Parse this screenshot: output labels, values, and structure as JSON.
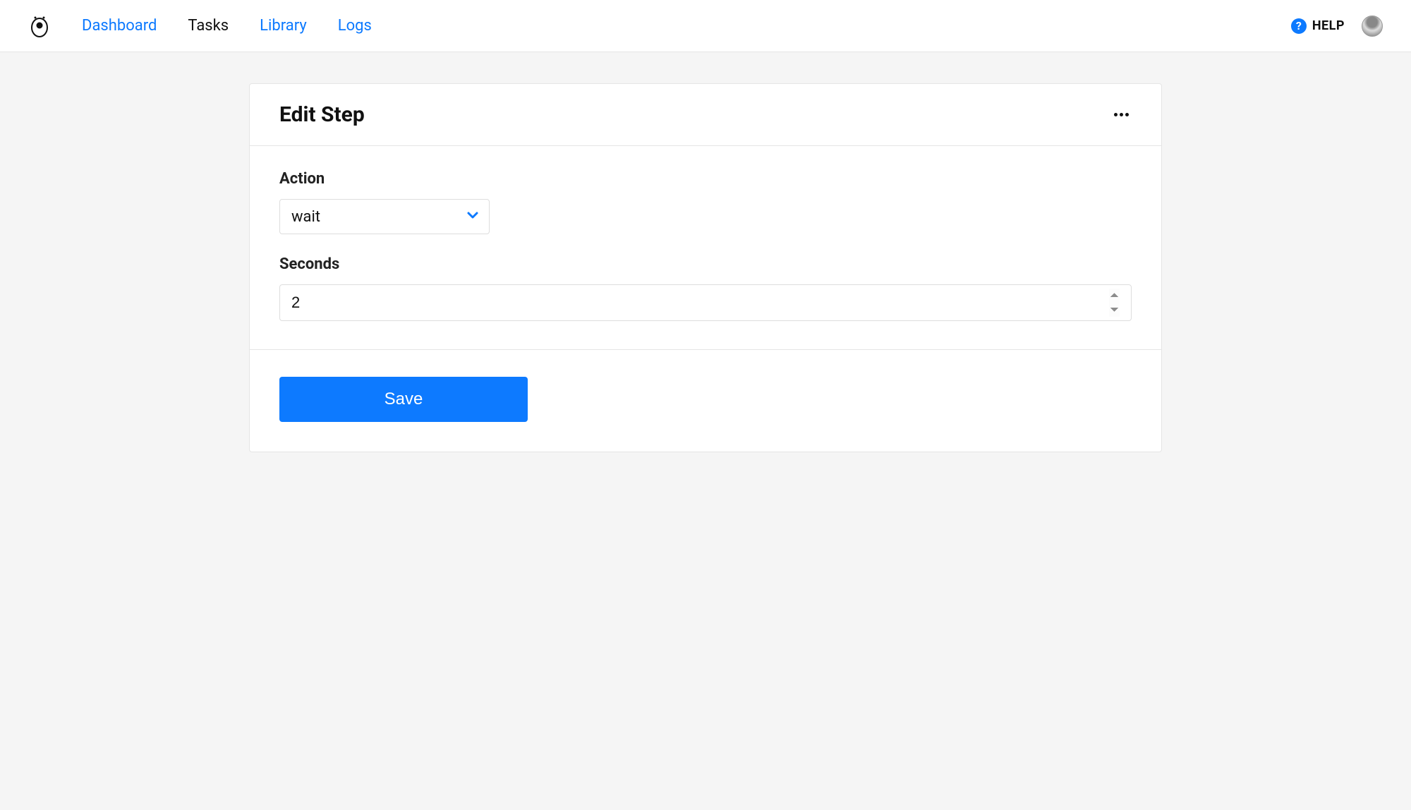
{
  "nav": {
    "items": [
      {
        "label": "Dashboard",
        "active": false
      },
      {
        "label": "Tasks",
        "active": true
      },
      {
        "label": "Library",
        "active": false
      },
      {
        "label": "Logs",
        "active": false
      }
    ]
  },
  "help": {
    "label": "HELP",
    "icon": "question-icon"
  },
  "card": {
    "title": "Edit Step",
    "fields": {
      "action": {
        "label": "Action",
        "value": "wait"
      },
      "seconds": {
        "label": "Seconds",
        "value": "2"
      }
    },
    "save_label": "Save"
  },
  "colors": {
    "accent": "#0d7aff",
    "text": "#111",
    "border": "#e5e5e5",
    "bg": "#f5f5f5"
  }
}
